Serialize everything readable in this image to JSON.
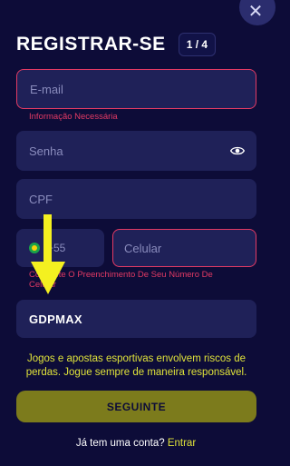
{
  "header": {
    "title": "REGISTRAR-SE",
    "step": "1 / 4",
    "close_icon": "close-icon"
  },
  "form": {
    "email": {
      "placeholder": "E-mail",
      "error": "Informação Necessária"
    },
    "password": {
      "placeholder": "Senha",
      "icon": "eye-icon"
    },
    "cpf": {
      "placeholder": "CPF"
    },
    "phone": {
      "country_flag": "brazil-flag-icon",
      "ddi": "+55",
      "placeholder": "Celular",
      "error": "Complete O Preenchimento De Seu Número De Celular"
    },
    "promo_code": {
      "value": "GDPMAX"
    }
  },
  "notice": "Jogos e apostas esportivas envolvem riscos de perdas. Jogue sempre de maneira responsável.",
  "next_button": "SEGUINTE",
  "login": {
    "prompt": "Já tem uma conta?",
    "link": "Entrar"
  },
  "colors": {
    "background": "#0d0c38",
    "field": "#1f2158",
    "error": "#e33a64",
    "accent": "#dfe23a",
    "button": "#7c7b1c",
    "arrow": "#f4f020"
  }
}
